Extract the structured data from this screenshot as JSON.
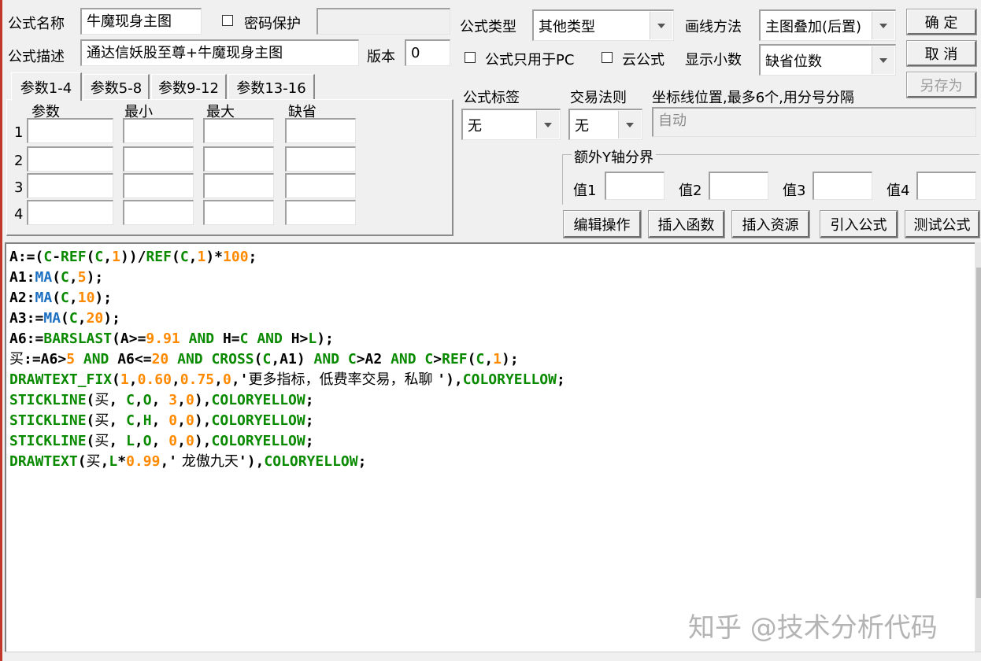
{
  "header": {
    "formula_name_label": "公式名称",
    "formula_name_value": "牛魔现身主图",
    "password_label": "密码保护",
    "description_label": "公式描述",
    "description_value": "通达信妖股至尊+牛魔现身主图",
    "version_label": "版本",
    "version_value": "0",
    "formula_type_label": "公式类型",
    "formula_type_value": "其他类型",
    "draw_method_label": "画线方法",
    "draw_method_value": "主图叠加(后置)",
    "pc_only_label": "公式只用于PC",
    "cloud_label": "云公式",
    "decimals_label": "显示小数",
    "decimals_value": "缺省位数"
  },
  "buttons": {
    "ok": "确 定",
    "cancel": "取 消",
    "save_as": "另存为",
    "edit_ops": "编辑操作",
    "insert_func": "插入函数",
    "insert_resource": "插入资源",
    "import_formula": "引入公式",
    "test_formula": "测试公式"
  },
  "tabs": [
    "参数1-4",
    "参数5-8",
    "参数9-12",
    "参数13-16"
  ],
  "params": {
    "col_headers": [
      "参数",
      "最小",
      "最大",
      "缺省"
    ],
    "rows": [
      "1",
      "2",
      "3",
      "4"
    ]
  },
  "options": {
    "tag_label": "公式标签",
    "tag_value": "无",
    "trade_rule_label": "交易法则",
    "trade_rule_value": "无",
    "axis_label": "坐标线位置,最多6个,用分号分隔",
    "axis_placeholder": "自动",
    "y_group_label": "额外Y轴分界",
    "y_values": [
      "值1",
      "值2",
      "值3",
      "值4"
    ]
  },
  "code_lines": [
    [
      [
        "k",
        "A:=("
      ],
      [
        "g",
        "C"
      ],
      [
        "k",
        "-"
      ],
      [
        "g",
        "REF"
      ],
      [
        "k",
        "("
      ],
      [
        "g",
        "C"
      ],
      [
        "k",
        ","
      ],
      [
        "o",
        "1"
      ],
      [
        "k",
        "))/"
      ],
      [
        "g",
        "REF"
      ],
      [
        "k",
        "("
      ],
      [
        "g",
        "C"
      ],
      [
        "k",
        ","
      ],
      [
        "o",
        "1"
      ],
      [
        "k",
        ")*"
      ],
      [
        "o",
        "100"
      ],
      [
        "k",
        ";"
      ]
    ],
    [
      [
        "k",
        "A1:"
      ],
      [
        "b",
        "MA"
      ],
      [
        "k",
        "("
      ],
      [
        "g",
        "C"
      ],
      [
        "k",
        ","
      ],
      [
        "o",
        "5"
      ],
      [
        "k",
        ");"
      ]
    ],
    [
      [
        "k",
        "A2:"
      ],
      [
        "b",
        "MA"
      ],
      [
        "k",
        "("
      ],
      [
        "g",
        "C"
      ],
      [
        "k",
        ","
      ],
      [
        "o",
        "10"
      ],
      [
        "k",
        ");"
      ]
    ],
    [
      [
        "k",
        "A3:="
      ],
      [
        "b",
        "MA"
      ],
      [
        "k",
        "("
      ],
      [
        "g",
        "C"
      ],
      [
        "k",
        ","
      ],
      [
        "o",
        "20"
      ],
      [
        "k",
        ");"
      ]
    ],
    [
      [
        "k",
        "A6:="
      ],
      [
        "g",
        "BARSLAST"
      ],
      [
        "k",
        "(A>="
      ],
      [
        "o",
        "9.91"
      ],
      [
        "g",
        " AND "
      ],
      [
        "k",
        "H="
      ],
      [
        "g",
        "C"
      ],
      [
        "g",
        " AND "
      ],
      [
        "k",
        "H>"
      ],
      [
        "g",
        "L"
      ],
      [
        "k",
        ");"
      ]
    ],
    [
      [
        "t",
        "买"
      ],
      [
        "k",
        ":=A6>"
      ],
      [
        "o",
        "5"
      ],
      [
        "g",
        " AND "
      ],
      [
        "k",
        "A6<="
      ],
      [
        "o",
        "20"
      ],
      [
        "g",
        " AND "
      ],
      [
        "g",
        "CROSS"
      ],
      [
        "k",
        "("
      ],
      [
        "g",
        "C"
      ],
      [
        "k",
        ",A1)"
      ],
      [
        "g",
        " AND "
      ],
      [
        "g",
        "C"
      ],
      [
        "k",
        ">A2"
      ],
      [
        "g",
        " AND "
      ],
      [
        "g",
        "C"
      ],
      [
        "k",
        ">"
      ],
      [
        "g",
        "REF"
      ],
      [
        "k",
        "("
      ],
      [
        "g",
        "C"
      ],
      [
        "k",
        ","
      ],
      [
        "o",
        "1"
      ],
      [
        "k",
        ");"
      ]
    ],
    [
      [
        "g",
        "DRAWTEXT_FIX"
      ],
      [
        "k",
        "("
      ],
      [
        "o",
        "1"
      ],
      [
        "k",
        ","
      ],
      [
        "o",
        "0.60"
      ],
      [
        "k",
        ","
      ],
      [
        "o",
        "0.75"
      ],
      [
        "k",
        ","
      ],
      [
        "o",
        "0"
      ],
      [
        "k",
        ",'"
      ],
      [
        "t",
        "更多指标，低费率交易，私聊 "
      ],
      [
        "k",
        "'),"
      ],
      [
        "g",
        "COLORYELLOW"
      ],
      [
        "k",
        ";"
      ]
    ],
    [
      [
        "g",
        "STICKLINE"
      ],
      [
        "k",
        "("
      ],
      [
        "t",
        "买"
      ],
      [
        "k",
        ", "
      ],
      [
        "g",
        "C"
      ],
      [
        "k",
        ","
      ],
      [
        "g",
        "O"
      ],
      [
        "k",
        ", "
      ],
      [
        "o",
        "3"
      ],
      [
        "k",
        ","
      ],
      [
        "o",
        "0"
      ],
      [
        "k",
        "),"
      ],
      [
        "g",
        "COLORYELLOW"
      ],
      [
        "k",
        ";"
      ]
    ],
    [
      [
        "g",
        "STICKLINE"
      ],
      [
        "k",
        "("
      ],
      [
        "t",
        "买"
      ],
      [
        "k",
        ", "
      ],
      [
        "g",
        "C"
      ],
      [
        "k",
        ","
      ],
      [
        "g",
        "H"
      ],
      [
        "k",
        ", "
      ],
      [
        "o",
        "0"
      ],
      [
        "k",
        ","
      ],
      [
        "o",
        "0"
      ],
      [
        "k",
        "),"
      ],
      [
        "g",
        "COLORYELLOW"
      ],
      [
        "k",
        ";"
      ]
    ],
    [
      [
        "g",
        "STICKLINE"
      ],
      [
        "k",
        "("
      ],
      [
        "t",
        "买"
      ],
      [
        "k",
        ", "
      ],
      [
        "g",
        "L"
      ],
      [
        "k",
        ","
      ],
      [
        "g",
        "O"
      ],
      [
        "k",
        ", "
      ],
      [
        "o",
        "0"
      ],
      [
        "k",
        ","
      ],
      [
        "o",
        "0"
      ],
      [
        "k",
        "),"
      ],
      [
        "g",
        "COLORYELLOW"
      ],
      [
        "k",
        ";"
      ]
    ],
    [
      [
        "g",
        "DRAWTEXT"
      ],
      [
        "k",
        "("
      ],
      [
        "t",
        "买"
      ],
      [
        "k",
        ","
      ],
      [
        "g",
        "L"
      ],
      [
        "k",
        "*"
      ],
      [
        "o",
        "0.99"
      ],
      [
        "k",
        ",'"
      ],
      [
        "t",
        " 龙傲九天"
      ],
      [
        "k",
        "'),"
      ],
      [
        "g",
        "COLORYELLOW"
      ],
      [
        "k",
        ";"
      ]
    ]
  ],
  "watermark": "知乎 @技术分析代码",
  "colors": {
    "keyword_green": "#0a8a00",
    "function_blue": "#1b6fc1",
    "number_orange": "#ff8a00"
  }
}
